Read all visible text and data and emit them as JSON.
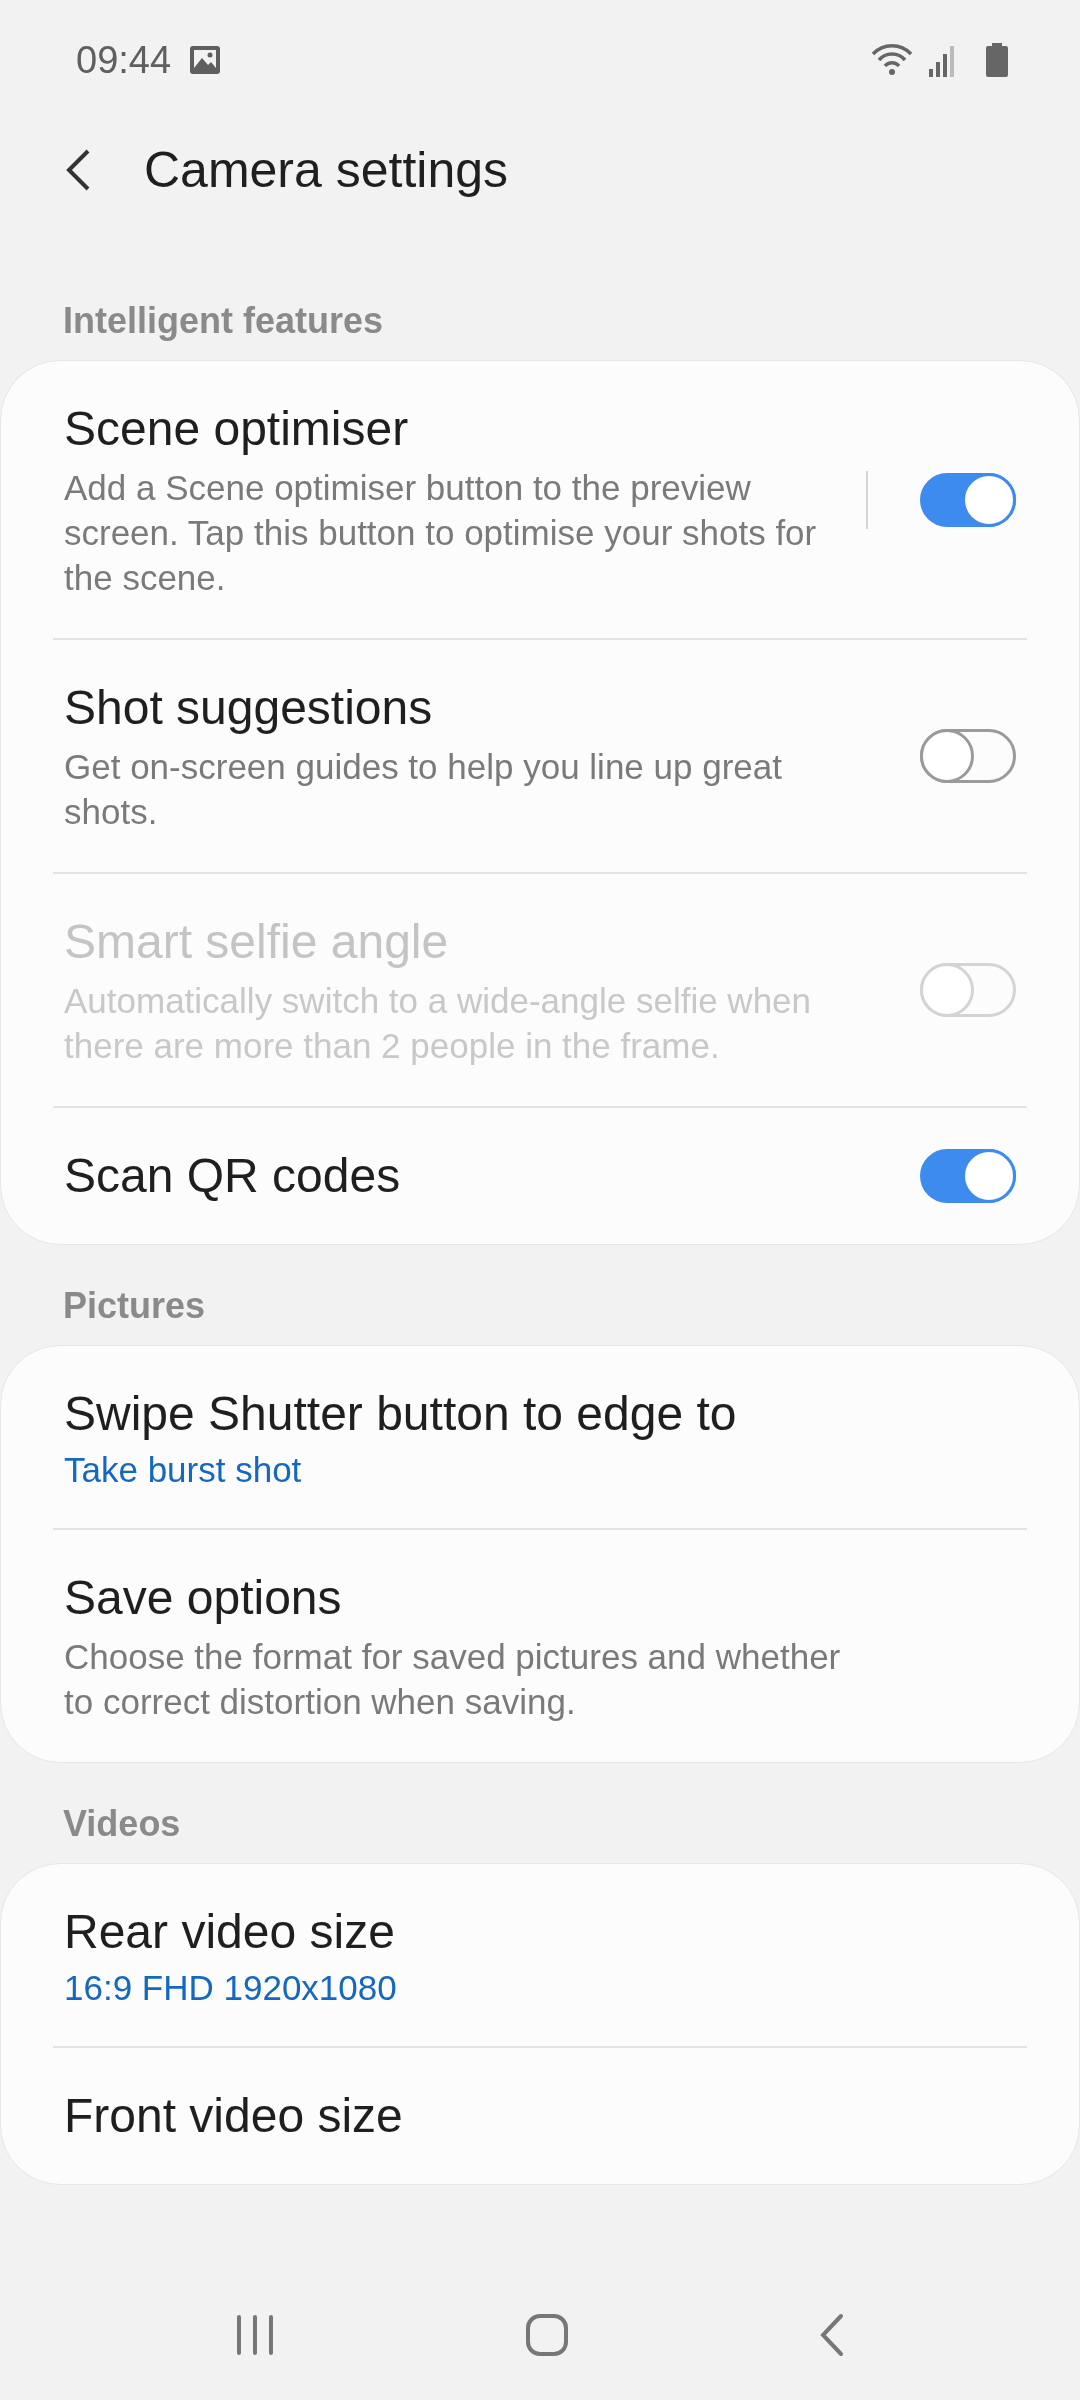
{
  "status_bar": {
    "time": "09:44"
  },
  "app_bar": {
    "title": "Camera settings"
  },
  "sections": [
    {
      "header": "Intelligent features",
      "items": [
        {
          "kind": "switch",
          "title": "Scene optimiser",
          "summary": "Add a Scene optimiser button to the preview screen. Tap this button to optimise your shots for the scene.",
          "on": true,
          "disabled": false,
          "divider": true
        },
        {
          "kind": "switch",
          "title": "Shot suggestions",
          "summary": "Get on-screen guides to help you line up great shots.",
          "on": false,
          "disabled": false,
          "divider": false
        },
        {
          "kind": "switch",
          "title": "Smart selfie angle",
          "summary": "Automatically switch to a wide-angle selfie when there are more than 2 people in the frame.",
          "on": false,
          "disabled": true,
          "divider": false
        },
        {
          "kind": "switch",
          "title": "Scan QR codes",
          "on": true,
          "disabled": false,
          "divider": false
        }
      ]
    },
    {
      "header": "Pictures",
      "items": [
        {
          "kind": "value",
          "title": "Swipe Shutter button to edge to",
          "value": "Take burst shot"
        },
        {
          "kind": "plain",
          "title": "Save options",
          "summary": "Choose the format for saved pictures and whether to correct distortion when saving."
        }
      ]
    },
    {
      "header": "Videos",
      "items": [
        {
          "kind": "value",
          "title": "Rear video size",
          "value": "16:9 FHD 1920x1080"
        },
        {
          "kind": "plain",
          "title": "Front video size"
        }
      ]
    }
  ]
}
